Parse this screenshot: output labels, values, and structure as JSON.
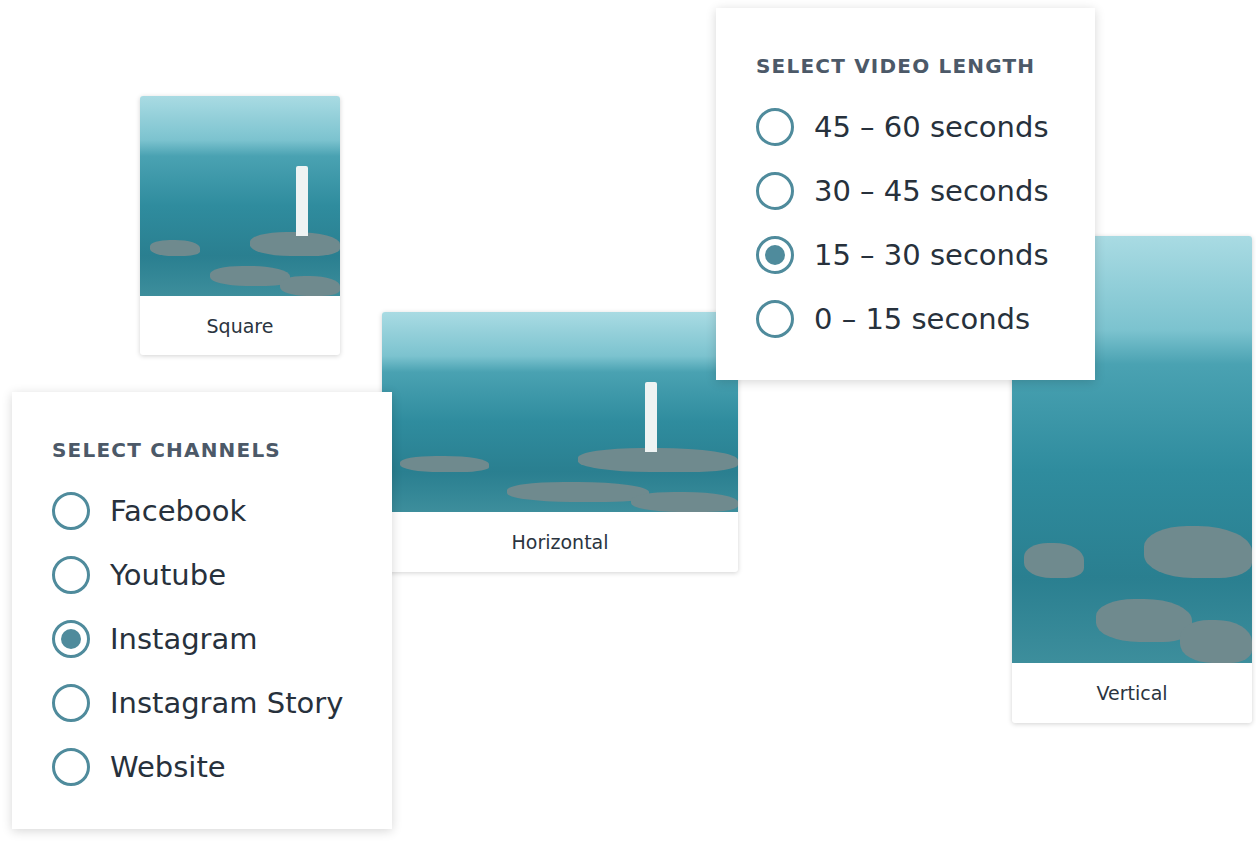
{
  "cards": [
    {
      "label": "Square"
    },
    {
      "label": "Horizontal"
    },
    {
      "label": "Vertical"
    }
  ],
  "video_length": {
    "title": "SELECT VIDEO LENGTH",
    "options": [
      {
        "label": "45 – 60 seconds",
        "selected": false
      },
      {
        "label": "30 – 45 seconds",
        "selected": false
      },
      {
        "label": "15 – 30 seconds",
        "selected": true
      },
      {
        "label": "0 – 15 seconds",
        "selected": false
      }
    ]
  },
  "channels": {
    "title": "SELECT CHANNELS",
    "options": [
      {
        "label": "Facebook",
        "selected": false
      },
      {
        "label": "Youtube",
        "selected": false
      },
      {
        "label": "Instagram",
        "selected": true
      },
      {
        "label": "Instagram Story",
        "selected": false
      },
      {
        "label": "Website",
        "selected": false
      }
    ]
  }
}
